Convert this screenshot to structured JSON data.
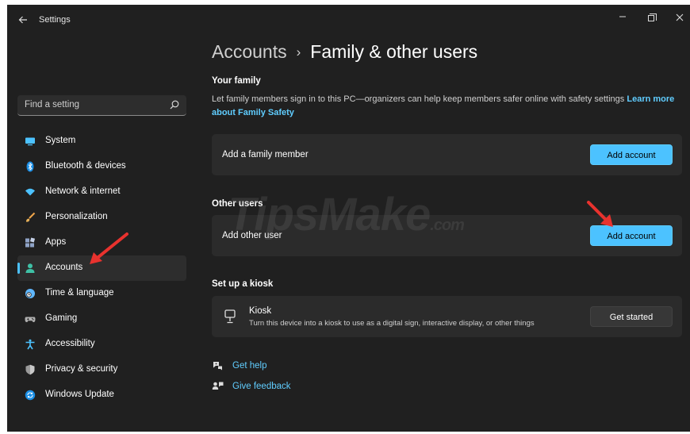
{
  "window": {
    "title": "Settings"
  },
  "search": {
    "placeholder": "Find a setting"
  },
  "sidebar": {
    "items": [
      {
        "label": "System",
        "icon": "monitor-icon",
        "color": "#4cc2ff"
      },
      {
        "label": "Bluetooth & devices",
        "icon": "bluetooth-icon",
        "color": "#1b8fe6"
      },
      {
        "label": "Network & internet",
        "icon": "wifi-icon",
        "color": "#4cc2ff"
      },
      {
        "label": "Personalization",
        "icon": "brush-icon",
        "color": "#f0a54a"
      },
      {
        "label": "Apps",
        "icon": "apps-icon",
        "color": "#8fa3c7"
      },
      {
        "label": "Accounts",
        "icon": "person-icon",
        "color": "#3fc1a6",
        "active": true
      },
      {
        "label": "Time & language",
        "icon": "globe-clock-icon",
        "color": "#60b8ff"
      },
      {
        "label": "Gaming",
        "icon": "gamepad-icon",
        "color": "#b0b0b0"
      },
      {
        "label": "Accessibility",
        "icon": "accessibility-icon",
        "color": "#4cc2ff"
      },
      {
        "label": "Privacy & security",
        "icon": "shield-icon",
        "color": "#9a9a9a"
      },
      {
        "label": "Windows Update",
        "icon": "update-icon",
        "color": "#1b8fe6"
      }
    ]
  },
  "breadcrumb": {
    "parent": "Accounts",
    "separator": "›",
    "current": "Family & other users"
  },
  "family": {
    "heading": "Your family",
    "description": "Let family members sign in to this PC—organizers can help keep members safer online with safety settings",
    "link": "Learn more about Family Safety",
    "card_label": "Add a family member",
    "button": "Add account"
  },
  "other_users": {
    "heading": "Other users",
    "card_label": "Add other user",
    "button": "Add account"
  },
  "kiosk": {
    "heading": "Set up a kiosk",
    "title": "Kiosk",
    "subtitle": "Turn this device into a kiosk to use as a digital sign, interactive display, or other things",
    "button": "Get started"
  },
  "help": {
    "get_help": "Get help",
    "give_feedback": "Give feedback"
  },
  "watermark": {
    "main": "TipsMake",
    "suffix": ".com"
  },
  "colors": {
    "accent": "#4cc2ff",
    "link": "#60cdff",
    "annotation_arrow": "#e8322e"
  }
}
